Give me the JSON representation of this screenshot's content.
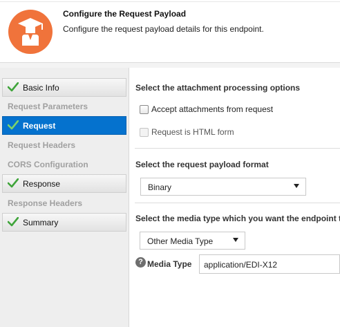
{
  "header": {
    "title": "Configure the Request Payload",
    "subtitle": "Configure the request payload details for this endpoint.",
    "icon": "graduate-icon",
    "accent_color": "#f0733b"
  },
  "nav": {
    "items": [
      {
        "label": "Basic Info",
        "state": "done"
      },
      {
        "label": "Request Parameters",
        "state": "sub"
      },
      {
        "label": "Request",
        "state": "active"
      },
      {
        "label": "Request Headers",
        "state": "sub"
      },
      {
        "label": "CORS Configuration",
        "state": "sub"
      },
      {
        "label": "Response",
        "state": "done"
      },
      {
        "label": "Response Headers",
        "state": "sub"
      },
      {
        "label": "Summary",
        "state": "done"
      }
    ],
    "active_color": "#0572ce",
    "check_color": "#3fa43a"
  },
  "attachments": {
    "title": "Select the attachment processing options",
    "accept_label": "Accept attachments from request",
    "accept_checked": false,
    "html_form_label": "Request is HTML form",
    "html_form_checked": false
  },
  "payload_format": {
    "title": "Select the request payload format",
    "selected": "Binary"
  },
  "media": {
    "title": "Select the media type which you want the endpoint t",
    "selected": "Other Media Type",
    "field_label": "Media Type",
    "field_value": "application/EDI-X12",
    "help_glyph": "?"
  }
}
